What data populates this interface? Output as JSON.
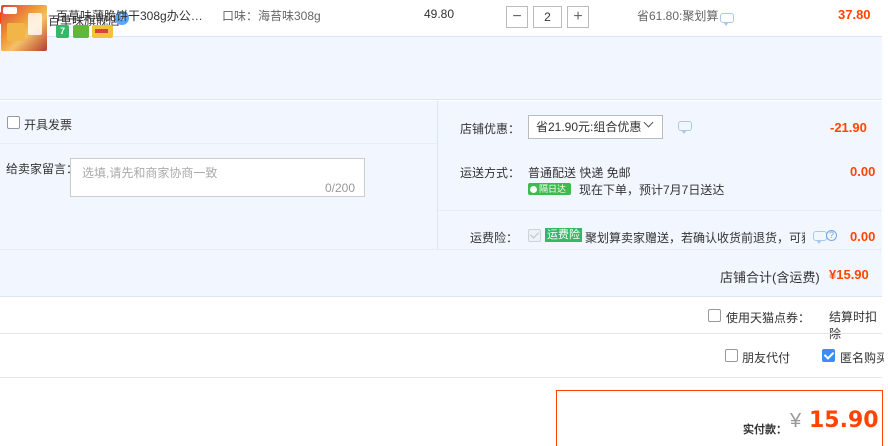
{
  "shop": {
    "label": "店铺：百草味旗舰店",
    "badge": "1"
  },
  "item": {
    "title": "百草味薄脆饼干308g办公室早...",
    "tag_text": "7",
    "sku": "口味：海苔味308g",
    "unit_price": "49.80",
    "quantity": "2",
    "minus_label": "−",
    "plus_label": "+",
    "discount_note": "省61.80:聚划算",
    "total": "37.80"
  },
  "invoice": {
    "label": "开具发票"
  },
  "message": {
    "label": "给卖家留言：",
    "placeholder": "选填,请先和商家协商一致",
    "count": "0/200"
  },
  "coupon": {
    "label": "店铺优惠：",
    "selected": "省21.90元:组合优惠",
    "amount": "-21.90"
  },
  "shipping": {
    "label": "运送方式：",
    "method": "普通配送 快递 免邮",
    "badge": "隔日达",
    "eta": "现在下单，预计7月7日送达",
    "amount": "0.00"
  },
  "insurance": {
    "label": "运费险：",
    "tag": "运费险",
    "desc": "聚划算卖家赠送，若确认收货前退货，可获...",
    "help": "?",
    "amount": "0.00"
  },
  "subtotal": {
    "label": "店铺合计(含运费)",
    "amount": "¥15.90"
  },
  "points": {
    "label": "使用天猫点券：",
    "note": "结算时扣除"
  },
  "options": {
    "friend_pay": "朋友代付",
    "anonymous": "匿名购买"
  },
  "payment": {
    "label": "实付款：",
    "currency": "¥",
    "amount": "15.90"
  }
}
